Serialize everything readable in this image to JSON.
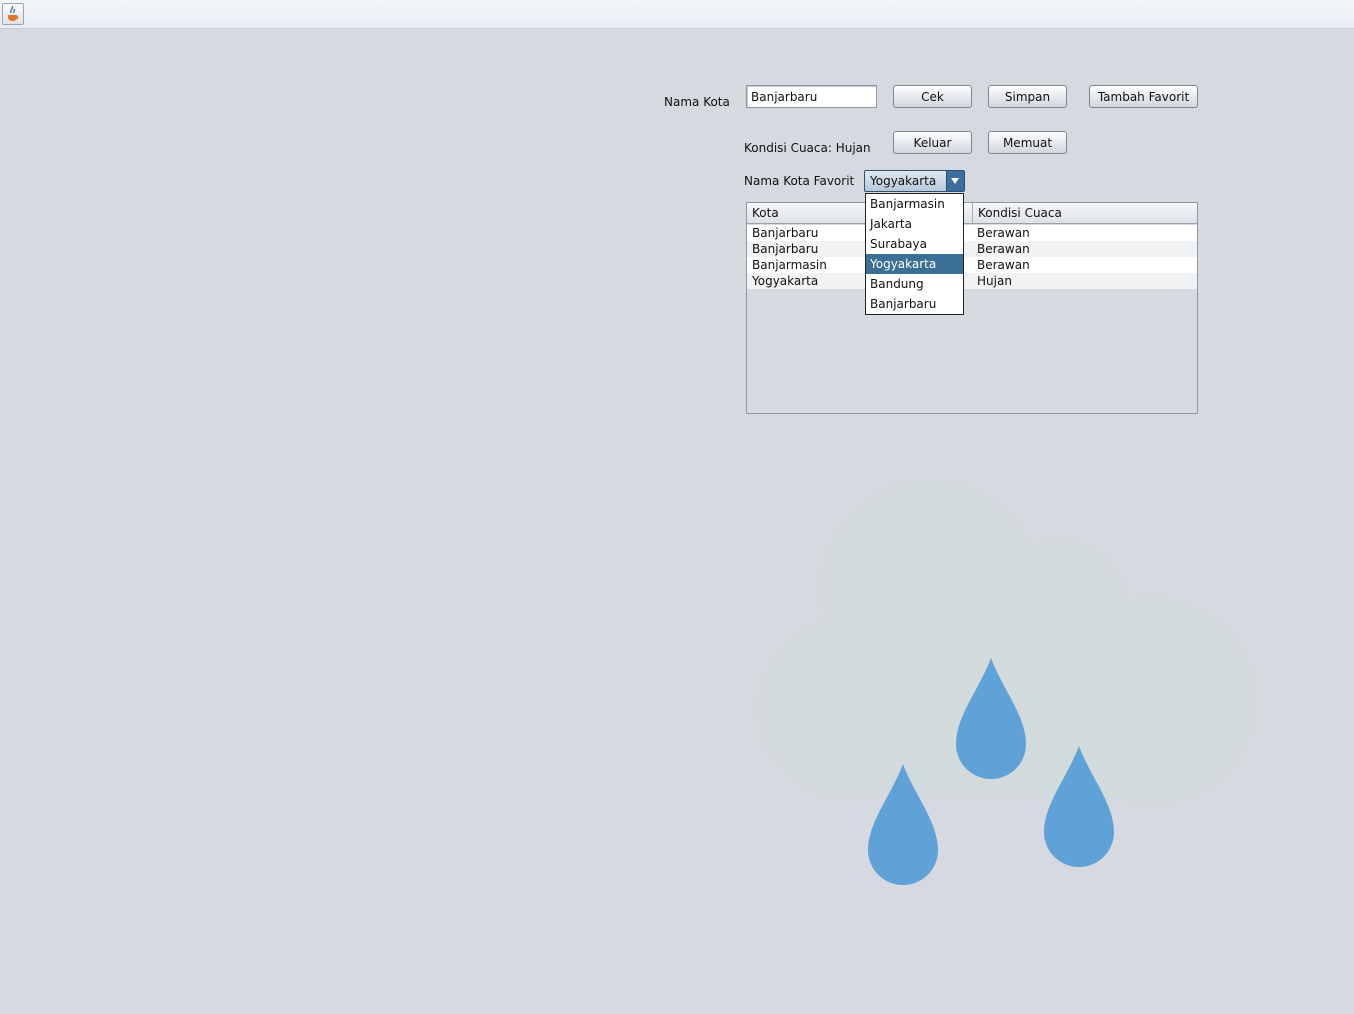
{
  "window": {
    "icon": "java-cup-icon"
  },
  "form": {
    "nama_kota_label": "Nama Kota",
    "nama_kota_value": "Banjarbaru",
    "kondisi_label": "Kondisi Cuaca: Hujan",
    "favorit_label": "Nama Kota Favorit"
  },
  "buttons": {
    "cek": "Cek",
    "simpan": "Simpan",
    "tambah_favorit": "Tambah Favorit",
    "keluar": "Keluar",
    "memuat": "Memuat"
  },
  "combo": {
    "selected": "Yogyakarta",
    "options": [
      "Banjarmasin",
      "Jakarta",
      "Surabaya",
      "Yogyakarta",
      "Bandung",
      "Banjarbaru"
    ]
  },
  "table": {
    "columns": [
      "Kota",
      "Kondisi Cuaca"
    ],
    "rows": [
      [
        "Banjarbaru",
        "Berawan"
      ],
      [
        "Banjarbaru",
        "Berawan"
      ],
      [
        "Banjarmasin",
        "Berawan"
      ],
      [
        "Yogyakarta",
        "Hujan"
      ]
    ]
  },
  "weather_image": {
    "icon": "rain-cloud-icon",
    "cloud_color": "#d2dadc",
    "drop_color": "#5ea2d8"
  }
}
